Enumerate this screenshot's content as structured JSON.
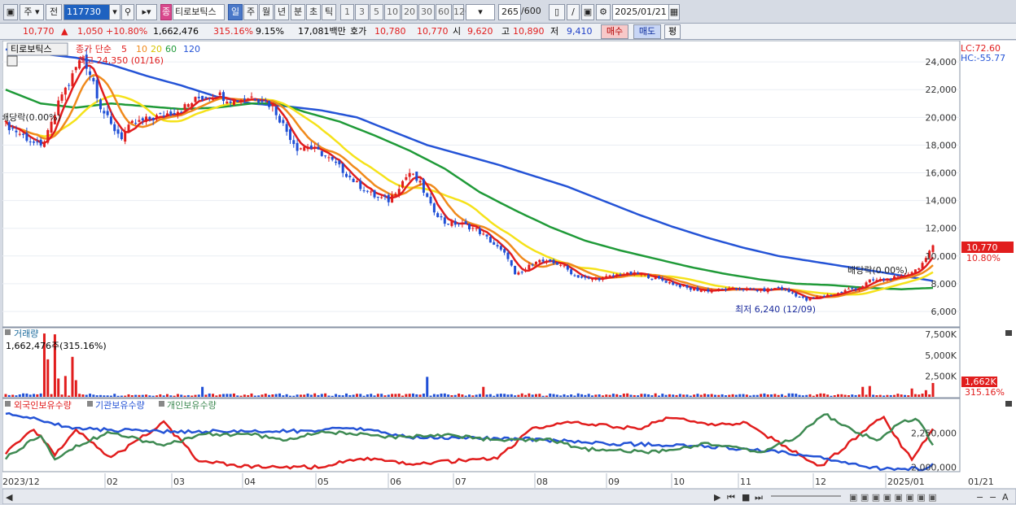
{
  "toolbar": {
    "period_tabs": [
      "주",
      "전"
    ],
    "code": "117730",
    "name_tag": "종",
    "stock_name": "티로보틱스",
    "timeframes": [
      "일",
      "주",
      "월",
      "년",
      "분",
      "초",
      "틱"
    ],
    "selected_timeframe": "일",
    "minute_options": [
      "1",
      "3",
      "5",
      "10",
      "20",
      "30",
      "60",
      "120"
    ],
    "count": "265",
    "count_total": "/600",
    "date": "2025/01/21"
  },
  "quote": {
    "price": "10,770",
    "change": "1,050",
    "change_pct": "+10.80%",
    "volume": "1,662,476",
    "vol_ratio": "315.16%",
    "turnover": "9.15%",
    "amount": "17,081백만",
    "bid_label": "호가",
    "ask": "10,780",
    "bid": "10,770",
    "open_label": "시",
    "open": "9,620",
    "high_label": "고",
    "high": "10,890",
    "low_label": "저",
    "low": "9,410",
    "buy_button": "매수",
    "sell_button": "매도",
    "eval_button": "평"
  },
  "price_legend": {
    "stock": "티로보틱스",
    "ma_label": "종가 단순",
    "ma_periods": [
      "5",
      "10",
      "20",
      "60",
      "120"
    ],
    "ma_colors": [
      "#e11d1d",
      "#f08a1c",
      "#f5e21a",
      "#1f9a38",
      "#2453d6"
    ],
    "high_note": "최고 24,350 (01/16)",
    "low_note": "최저 6,240 (12/09)",
    "div_left": "배당락(0.00%)",
    "div_right": "배당락(0.00%)",
    "lc": "LC:72.60",
    "hc": "HC:-55.77",
    "current_price": "10,770",
    "current_pct": "10.80%"
  },
  "volume_legend": {
    "title": "거래량",
    "value": "1,662,476주(315.16%)",
    "current": "1,662K",
    "current_pct": "315.16%"
  },
  "holding_legend": [
    "외국인보유수량",
    "기관보유수량",
    "개인보유수량"
  ],
  "x_labels": [
    "2023/12",
    "02",
    "03",
    "04",
    "05",
    "06",
    "07",
    "08",
    "09",
    "10",
    "11",
    "12",
    "2025/01",
    "01/21"
  ],
  "chart_data": {
    "type": "candlestick",
    "price_axis": {
      "ticks": [
        6000,
        8000,
        10000,
        12000,
        14000,
        16000,
        18000,
        20000,
        22000,
        24000
      ],
      "range": [
        5000,
        25300
      ]
    },
    "price_path": [
      [
        0,
        19500
      ],
      [
        6,
        18500
      ],
      [
        10,
        17800
      ],
      [
        12,
        18800
      ],
      [
        14,
        20200
      ],
      [
        16,
        21700
      ],
      [
        18,
        22400
      ],
      [
        20,
        23600
      ],
      [
        22,
        24350
      ],
      [
        25,
        22600
      ],
      [
        27,
        20800
      ],
      [
        30,
        19400
      ],
      [
        33,
        18600
      ],
      [
        36,
        19500
      ],
      [
        40,
        19800
      ],
      [
        45,
        20200
      ],
      [
        50,
        20600
      ],
      [
        55,
        21400
      ],
      [
        60,
        21700
      ],
      [
        65,
        21200
      ],
      [
        70,
        21500
      ],
      [
        73,
        21300
      ],
      [
        76,
        20800
      ],
      [
        80,
        19000
      ],
      [
        83,
        17800
      ],
      [
        86,
        17900
      ],
      [
        90,
        17400
      ],
      [
        95,
        16400
      ],
      [
        100,
        15200
      ],
      [
        105,
        14300
      ],
      [
        109,
        14000
      ],
      [
        113,
        15400
      ],
      [
        115,
        16000
      ],
      [
        118,
        15200
      ],
      [
        121,
        13600
      ],
      [
        125,
        12400
      ],
      [
        130,
        12300
      ],
      [
        134,
        11900
      ],
      [
        137,
        11300
      ],
      [
        140,
        10600
      ],
      [
        143,
        9900
      ],
      [
        145,
        8600
      ],
      [
        147,
        8800
      ],
      [
        151,
        9700
      ],
      [
        155,
        9500
      ],
      [
        158,
        9400
      ],
      [
        162,
        8600
      ],
      [
        166,
        8300
      ],
      [
        170,
        8400
      ],
      [
        175,
        8700
      ],
      [
        180,
        8700
      ],
      [
        185,
        8400
      ],
      [
        190,
        8000
      ],
      [
        195,
        7600
      ],
      [
        200,
        7500
      ],
      [
        205,
        7600
      ],
      [
        210,
        7600
      ],
      [
        215,
        7500
      ],
      [
        220,
        7700
      ],
      [
        224,
        7300
      ],
      [
        228,
        6800
      ],
      [
        232,
        7100
      ],
      [
        237,
        7300
      ],
      [
        240,
        7600
      ],
      [
        243,
        7700
      ],
      [
        246,
        8200
      ],
      [
        250,
        8300
      ],
      [
        255,
        8500
      ],
      [
        259,
        9000
      ],
      [
        262,
        9720
      ],
      [
        264,
        10770
      ]
    ],
    "ma120_path": [
      [
        0,
        24900
      ],
      [
        10,
        24600
      ],
      [
        20,
        24300
      ],
      [
        30,
        23800
      ],
      [
        40,
        23000
      ],
      [
        50,
        22300
      ],
      [
        60,
        21500
      ],
      [
        70,
        21000
      ],
      [
        80,
        20800
      ],
      [
        90,
        20500
      ],
      [
        100,
        20000
      ],
      [
        110,
        19000
      ],
      [
        120,
        18000
      ],
      [
        130,
        17300
      ],
      [
        140,
        16600
      ],
      [
        150,
        15800
      ],
      [
        160,
        15000
      ],
      [
        170,
        14000
      ],
      [
        180,
        13000
      ],
      [
        190,
        12100
      ],
      [
        200,
        11300
      ],
      [
        210,
        10600
      ],
      [
        220,
        10000
      ],
      [
        230,
        9600
      ],
      [
        240,
        9200
      ],
      [
        250,
        8800
      ],
      [
        264,
        8200
      ]
    ],
    "ma60_path": [
      [
        0,
        22000
      ],
      [
        10,
        21000
      ],
      [
        20,
        20700
      ],
      [
        30,
        21000
      ],
      [
        40,
        20800
      ],
      [
        50,
        20600
      ],
      [
        60,
        20700
      ],
      [
        70,
        21000
      ],
      [
        78,
        21000
      ],
      [
        85,
        20400
      ],
      [
        95,
        19700
      ],
      [
        105,
        18700
      ],
      [
        115,
        17600
      ],
      [
        125,
        16300
      ],
      [
        135,
        14600
      ],
      [
        145,
        13300
      ],
      [
        155,
        12100
      ],
      [
        165,
        11100
      ],
      [
        175,
        10400
      ],
      [
        185,
        9800
      ],
      [
        195,
        9200
      ],
      [
        205,
        8700
      ],
      [
        215,
        8300
      ],
      [
        225,
        8000
      ],
      [
        235,
        7900
      ],
      [
        245,
        7700
      ],
      [
        255,
        7600
      ],
      [
        264,
        7700
      ]
    ],
    "volume_axis": {
      "ticks": [
        "2,500K",
        "5,000K",
        "7,500K"
      ],
      "max": 8000
    },
    "volume_spikes": [
      [
        11,
        7600
      ],
      [
        12,
        4500
      ],
      [
        14,
        7500
      ],
      [
        15,
        2200
      ],
      [
        17,
        2500
      ],
      [
        19,
        4800
      ],
      [
        20,
        2000
      ],
      [
        56,
        1200
      ],
      [
        120,
        2400
      ],
      [
        136,
        1200
      ],
      [
        244,
        1200
      ],
      [
        246,
        1300
      ],
      [
        258,
        1000
      ],
      [
        262,
        800
      ],
      [
        264,
        1662
      ]
    ],
    "holding_axis": {
      "ticks": [
        "2,000,000",
        "2,250,000"
      ]
    },
    "holding_series": [
      {
        "name": "외국인보유수량",
        "color": "#e11d1d",
        "points": [
          [
            0,
            0.3
          ],
          [
            8,
            0.7
          ],
          [
            14,
            0.25
          ],
          [
            20,
            0.7
          ],
          [
            30,
            0.2
          ],
          [
            45,
            0.8
          ],
          [
            55,
            0.15
          ],
          [
            70,
            0.05
          ],
          [
            90,
            0.05
          ],
          [
            100,
            0.2
          ],
          [
            115,
            0.1
          ],
          [
            140,
            0.2
          ],
          [
            150,
            0.7
          ],
          [
            160,
            0.8
          ],
          [
            180,
            0.7
          ],
          [
            190,
            0.9
          ],
          [
            200,
            0.75
          ],
          [
            210,
            0.8
          ],
          [
            225,
            0.3
          ],
          [
            232,
            0.05
          ],
          [
            238,
            0.35
          ],
          [
            245,
            0.7
          ],
          [
            250,
            0.9
          ],
          [
            255,
            0.4
          ],
          [
            258,
            0.2
          ],
          [
            264,
            0.7
          ]
        ]
      },
      {
        "name": "기관보유수량",
        "color": "#2453d6",
        "points": [
          [
            0,
            0.95
          ],
          [
            5,
            0.9
          ],
          [
            20,
            0.7
          ],
          [
            40,
            0.65
          ],
          [
            80,
            0.65
          ],
          [
            100,
            0.7
          ],
          [
            115,
            0.55
          ],
          [
            150,
            0.52
          ],
          [
            170,
            0.45
          ],
          [
            200,
            0.4
          ],
          [
            220,
            0.3
          ],
          [
            232,
            0.2
          ],
          [
            240,
            0.1
          ],
          [
            250,
            0.02
          ],
          [
            262,
            0.02
          ],
          [
            264,
            0.08
          ]
        ]
      },
      {
        "name": "개인보유수량",
        "color": "#3e8a52",
        "points": [
          [
            0,
            0.2
          ],
          [
            10,
            0.6
          ],
          [
            14,
            0.2
          ],
          [
            20,
            0.4
          ],
          [
            30,
            0.65
          ],
          [
            45,
            0.4
          ],
          [
            55,
            0.6
          ],
          [
            70,
            0.6
          ],
          [
            80,
            0.5
          ],
          [
            90,
            0.65
          ],
          [
            110,
            0.55
          ],
          [
            125,
            0.6
          ],
          [
            140,
            0.5
          ],
          [
            155,
            0.5
          ],
          [
            165,
            0.35
          ],
          [
            185,
            0.3
          ],
          [
            200,
            0.45
          ],
          [
            215,
            0.3
          ],
          [
            225,
            0.55
          ],
          [
            233,
            0.95
          ],
          [
            240,
            0.7
          ],
          [
            248,
            0.5
          ],
          [
            255,
            0.8
          ],
          [
            260,
            0.85
          ],
          [
            264,
            0.4
          ]
        ]
      }
    ]
  }
}
